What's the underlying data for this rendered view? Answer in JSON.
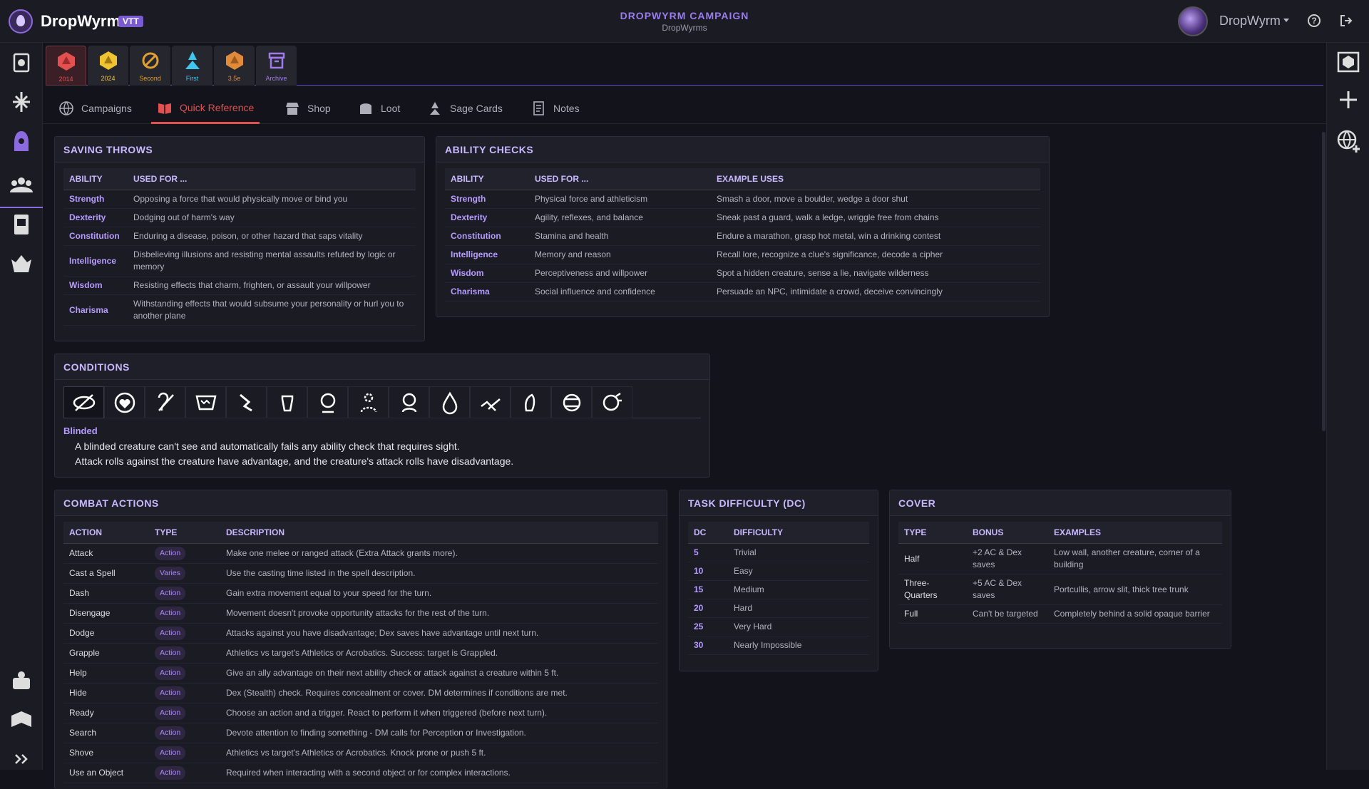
{
  "app": {
    "brand": "DropWyrm",
    "badge": "VTT"
  },
  "campaign": {
    "title": "DROPWYRM CAMPAIGN",
    "subtitle": "DropWyrms"
  },
  "user": {
    "name": "DropWyrm",
    "help_icon": "?"
  },
  "game_tabs": [
    {
      "label": "2014",
      "color": "#e2504f"
    },
    {
      "label": "2024",
      "color": "#f0c330"
    },
    {
      "label": "Second",
      "color": "#e0a030"
    },
    {
      "label": "First",
      "color": "#3fc6f0"
    },
    {
      "label": "3.5e",
      "color": "#e08a3a"
    },
    {
      "label": "Archive",
      "color": "#a07ae8"
    }
  ],
  "nav_tabs": [
    "Campaigns",
    "Quick Reference",
    "Shop",
    "Loot",
    "Sage Cards",
    "Notes"
  ],
  "saving_throws": {
    "title": "SAVING THROWS",
    "headers": [
      "ABILITY",
      "USED FOR ..."
    ],
    "rows": [
      [
        "Strength",
        "Opposing a force that would physically move or bind you"
      ],
      [
        "Dexterity",
        "Dodging out of harm's way"
      ],
      [
        "Constitution",
        "Enduring a disease, poison, or other hazard that saps vitality"
      ],
      [
        "Intelligence",
        "Disbelieving illusions and resisting mental assaults refuted by logic or memory"
      ],
      [
        "Wisdom",
        "Resisting effects that charm, frighten, or assault your willpower"
      ],
      [
        "Charisma",
        "Withstanding effects that would subsume your personality or hurl you to another plane"
      ]
    ]
  },
  "ability_checks": {
    "title": "ABILITY CHECKS",
    "headers": [
      "ABILITY",
      "USED FOR ...",
      "EXAMPLE USES"
    ],
    "rows": [
      [
        "Strength",
        "Physical force and athleticism",
        "Smash a door, move a boulder, wedge a door shut"
      ],
      [
        "Dexterity",
        "Agility, reflexes, and balance",
        "Sneak past a guard, walk a ledge, wriggle free from chains"
      ],
      [
        "Constitution",
        "Stamina and health",
        "Endure a marathon, grasp hot metal, win a drinking contest"
      ],
      [
        "Intelligence",
        "Memory and reason",
        "Recall lore, recognize a clue's significance, decode a cipher"
      ],
      [
        "Wisdom",
        "Perceptiveness and willpower",
        "Spot a hidden creature, sense a lie, navigate wilderness"
      ],
      [
        "Charisma",
        "Social influence and confidence",
        "Persuade an NPC, intimidate a crowd, deceive convincingly"
      ]
    ]
  },
  "conditions": {
    "title": "CONDITIONS",
    "icons": [
      "blinded-icon",
      "charmed-icon",
      "deafened-icon",
      "exhaustion-icon",
      "frightened-icon",
      "grappled-icon",
      "incapacitated-icon",
      "invisible-icon",
      "paralyzed-icon",
      "petrified-icon",
      "poisoned-icon",
      "prone-icon",
      "restrained-icon",
      "stunned-icon"
    ],
    "selected_name": "Blinded",
    "selected_lines": [
      "A blinded creature can't see and automatically fails any ability check that requires sight.",
      "Attack rolls against the creature have advantage, and the creature's attack rolls have disadvantage."
    ]
  },
  "combat_actions": {
    "title": "COMBAT ACTIONS",
    "headers": [
      "ACTION",
      "TYPE",
      "DESCRIPTION"
    ],
    "rows": [
      [
        "Attack",
        "Action",
        "Make one melee or ranged attack (Extra Attack grants more)."
      ],
      [
        "Cast a Spell",
        "Varies",
        "Use the casting time listed in the spell description."
      ],
      [
        "Dash",
        "Action",
        "Gain extra movement equal to your speed for the turn."
      ],
      [
        "Disengage",
        "Action",
        "Movement doesn't provoke opportunity attacks for the rest of the turn."
      ],
      [
        "Dodge",
        "Action",
        "Attacks against you have disadvantage; Dex saves have advantage until next turn."
      ],
      [
        "Grapple",
        "Action",
        "Athletics vs target's Athletics or Acrobatics. Success: target is Grappled."
      ],
      [
        "Help",
        "Action",
        "Give an ally advantage on their next ability check or attack against a creature within 5 ft."
      ],
      [
        "Hide",
        "Action",
        "Dex (Stealth) check. Requires concealment or cover. DM determines if conditions are met."
      ],
      [
        "Ready",
        "Action",
        "Choose an action and a trigger. React to perform it when triggered (before next turn)."
      ],
      [
        "Search",
        "Action",
        "Devote attention to finding something - DM calls for Perception or Investigation."
      ],
      [
        "Shove",
        "Action",
        "Athletics vs target's Athletics or Acrobatics. Knock prone or push 5 ft."
      ],
      [
        "Use an Object",
        "Action",
        "Required when interacting with a second object or for complex interactions."
      ]
    ]
  },
  "task_difficulty": {
    "title": "TASK DIFFICULTY (DC)",
    "headers": [
      "DC",
      "DIFFICULTY"
    ],
    "rows": [
      [
        "5",
        "Trivial"
      ],
      [
        "10",
        "Easy"
      ],
      [
        "15",
        "Medium"
      ],
      [
        "20",
        "Hard"
      ],
      [
        "25",
        "Very Hard"
      ],
      [
        "30",
        "Nearly Impossible"
      ]
    ]
  },
  "cover": {
    "title": "COVER",
    "headers": [
      "TYPE",
      "BONUS",
      "EXAMPLES"
    ],
    "rows": [
      [
        "Half",
        "+2 AC & Dex saves",
        "Low wall, another creature, corner of a building"
      ],
      [
        "Three-Quarters",
        "+5 AC & Dex saves",
        "Portcullis, arrow slit, thick tree trunk"
      ],
      [
        "Full",
        "Can't be targeted",
        "Completely behind a solid opaque barrier"
      ]
    ]
  },
  "colors": {
    "accent": "#8c6be0",
    "active_tab": "#e2504f",
    "background": "#13131b",
    "panel": "#1b1b24"
  }
}
